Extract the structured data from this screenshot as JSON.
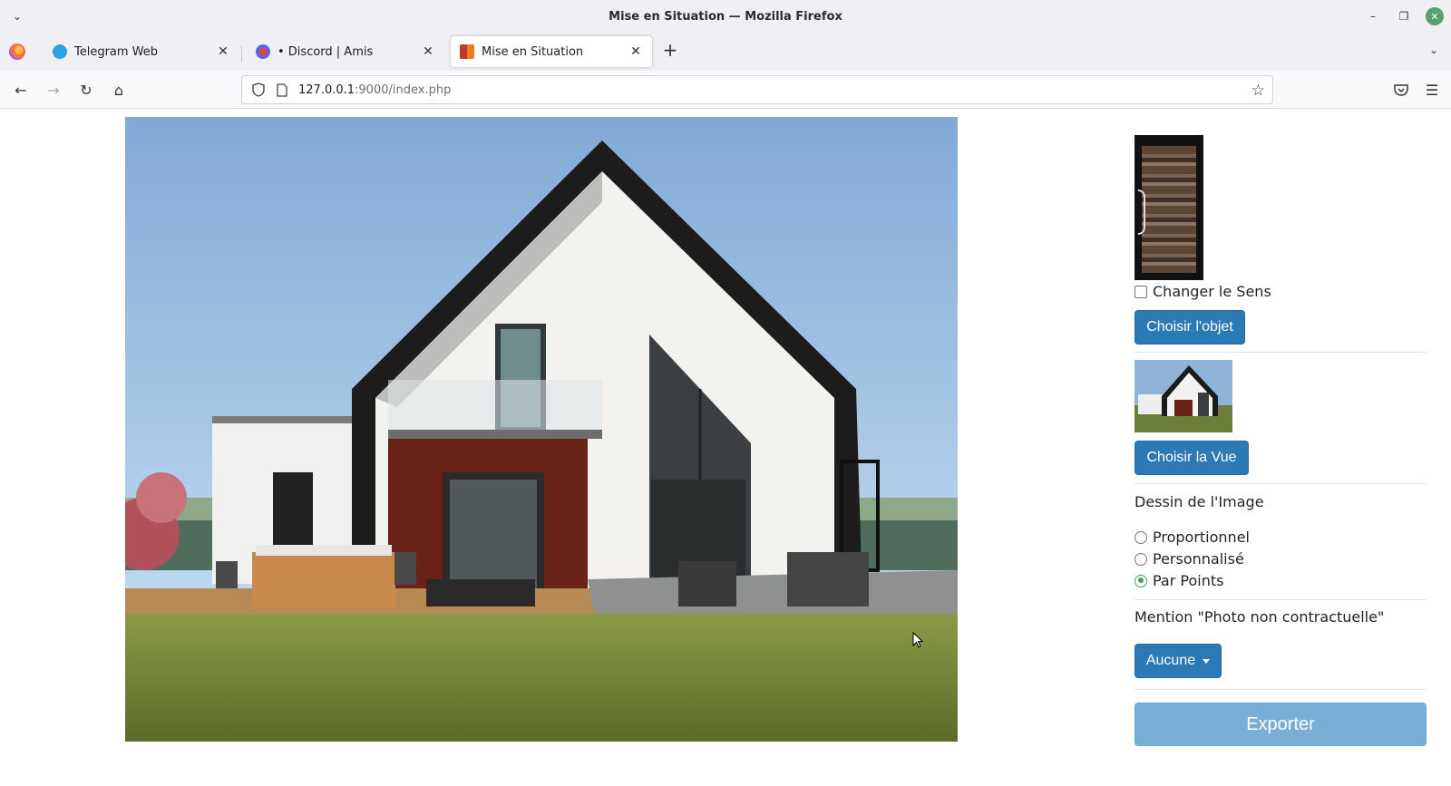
{
  "window": {
    "title": "Mise en Situation — Mozilla Firefox"
  },
  "tabs": [
    {
      "label": "Telegram Web",
      "icon": "telegram-icon",
      "active": false
    },
    {
      "label": "• Discord | Amis",
      "icon": "discord-icon",
      "active": false
    },
    {
      "label": "Mise en Situation",
      "icon": "site-icon",
      "active": true
    }
  ],
  "navbar": {
    "url_host": "127.0.0.1",
    "url_path": ":9000/index.php"
  },
  "sidebar": {
    "change_direction_label": "Changer le Sens",
    "change_direction_checked": false,
    "choose_object_label": "Choisir l'objet",
    "choose_view_label": "Choisir la Vue",
    "drawing_title": "Dessin de l'Image",
    "drawing_options": [
      {
        "label": "Proportionnel",
        "selected": false
      },
      {
        "label": "Personnalisé",
        "selected": false
      },
      {
        "label": "Par Points",
        "selected": true
      }
    ],
    "mention_title": "Mention \"Photo non contractuelle\"",
    "mention_value": "Aucune",
    "export_label": "Exporter"
  },
  "colors": {
    "button_blue": "#2c7ab5",
    "export_blue": "#79afd6",
    "radio_selected": "#4aa05a"
  }
}
